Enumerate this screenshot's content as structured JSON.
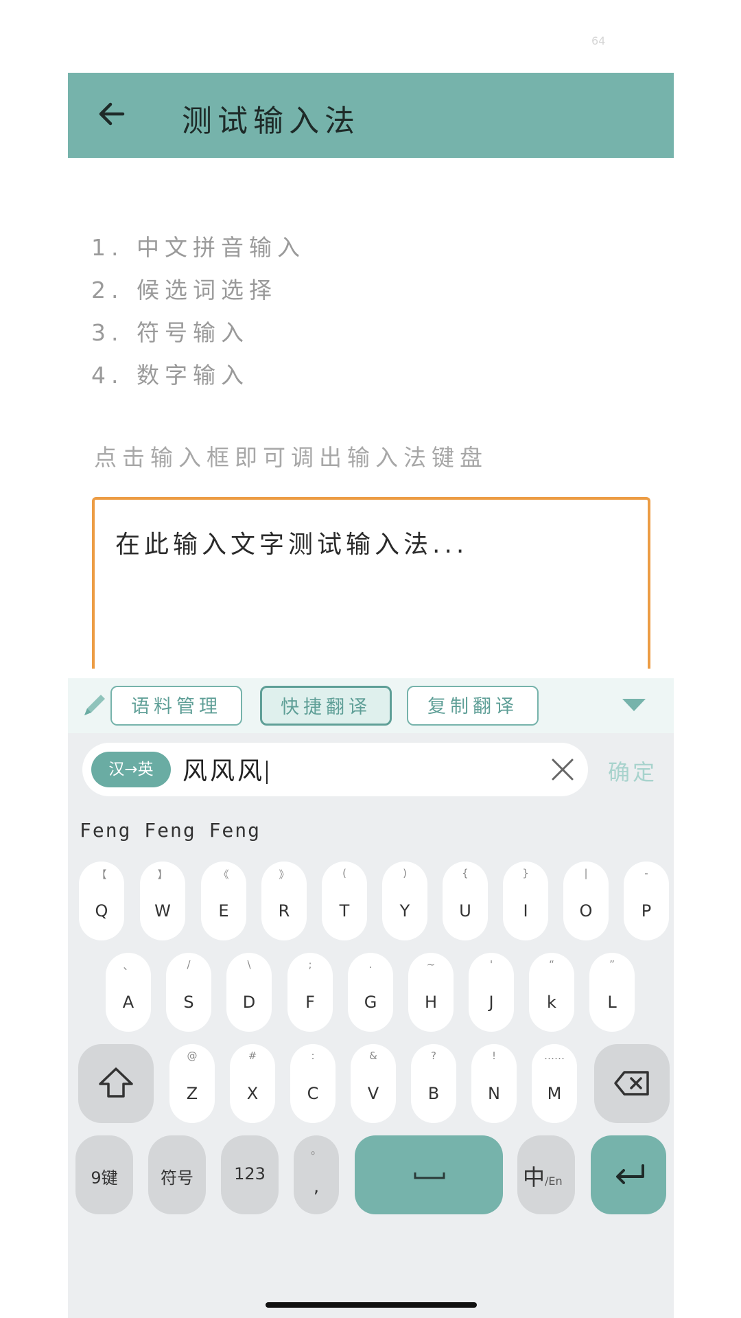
{
  "status": {
    "text": "64"
  },
  "appbar": {
    "title": "测试输入法",
    "back_icon": "arrow-left-icon",
    "color": "#76b3ab"
  },
  "features": [
    "1. 中文拼音输入",
    "2. 候选词选择",
    "3. 符号输入",
    "4. 数字输入"
  ],
  "hint": "点击输入框即可调出输入法键盘",
  "input": {
    "placeholder": "在此输入文字测试输入法...",
    "border_color": "#ec9c44"
  },
  "keyboard": {
    "toolbar": {
      "buttons": [
        "语料管理",
        "快捷翻译",
        "复制翻译"
      ],
      "active_index": 1,
      "collapse_icon": "triangle-down-icon",
      "edit_icon": "pencil-icon"
    },
    "translate": {
      "direction": "汉→英",
      "text": "风风风",
      "clear_icon": "close-icon",
      "confirm": "确定"
    },
    "candidate": "Feng Feng Feng",
    "row1": [
      {
        "sym": "【",
        "key": "Q"
      },
      {
        "sym": "】",
        "key": "W"
      },
      {
        "sym": "《",
        "key": "E"
      },
      {
        "sym": "》",
        "key": "R"
      },
      {
        "sym": "(",
        "key": "T"
      },
      {
        "sym": ")",
        "key": "Y"
      },
      {
        "sym": "{",
        "key": "U"
      },
      {
        "sym": "}",
        "key": "I"
      },
      {
        "sym": "|",
        "key": "O"
      },
      {
        "sym": "-",
        "key": "P"
      }
    ],
    "row2": [
      {
        "sym": "、",
        "key": "A"
      },
      {
        "sym": "/",
        "key": "S"
      },
      {
        "sym": "\\",
        "key": "D"
      },
      {
        "sym": ";",
        "key": "F"
      },
      {
        "sym": ".",
        "key": "G"
      },
      {
        "sym": "~",
        "key": "H"
      },
      {
        "sym": "'",
        "key": "J"
      },
      {
        "sym": "“",
        "key": "k"
      },
      {
        "sym": "”",
        "key": "L"
      }
    ],
    "row3": [
      {
        "sym": "@",
        "key": "Z"
      },
      {
        "sym": "#",
        "key": "X"
      },
      {
        "sym": ":",
        "key": "C"
      },
      {
        "sym": "&",
        "key": "V"
      },
      {
        "sym": "?",
        "key": "B"
      },
      {
        "sym": "!",
        "key": "N"
      },
      {
        "sym": "……",
        "key": "M"
      }
    ],
    "shift_icon": "shift-icon",
    "backspace_icon": "backspace-icon",
    "bottom": {
      "nine_key": "9键",
      "symbols": "符号",
      "numbers": "123",
      "punct_top": "。",
      "punct_bottom": ",",
      "space_icon": "space-icon",
      "lang_main": "中",
      "lang_sub": "/En",
      "enter_icon": "enter-icon"
    }
  }
}
